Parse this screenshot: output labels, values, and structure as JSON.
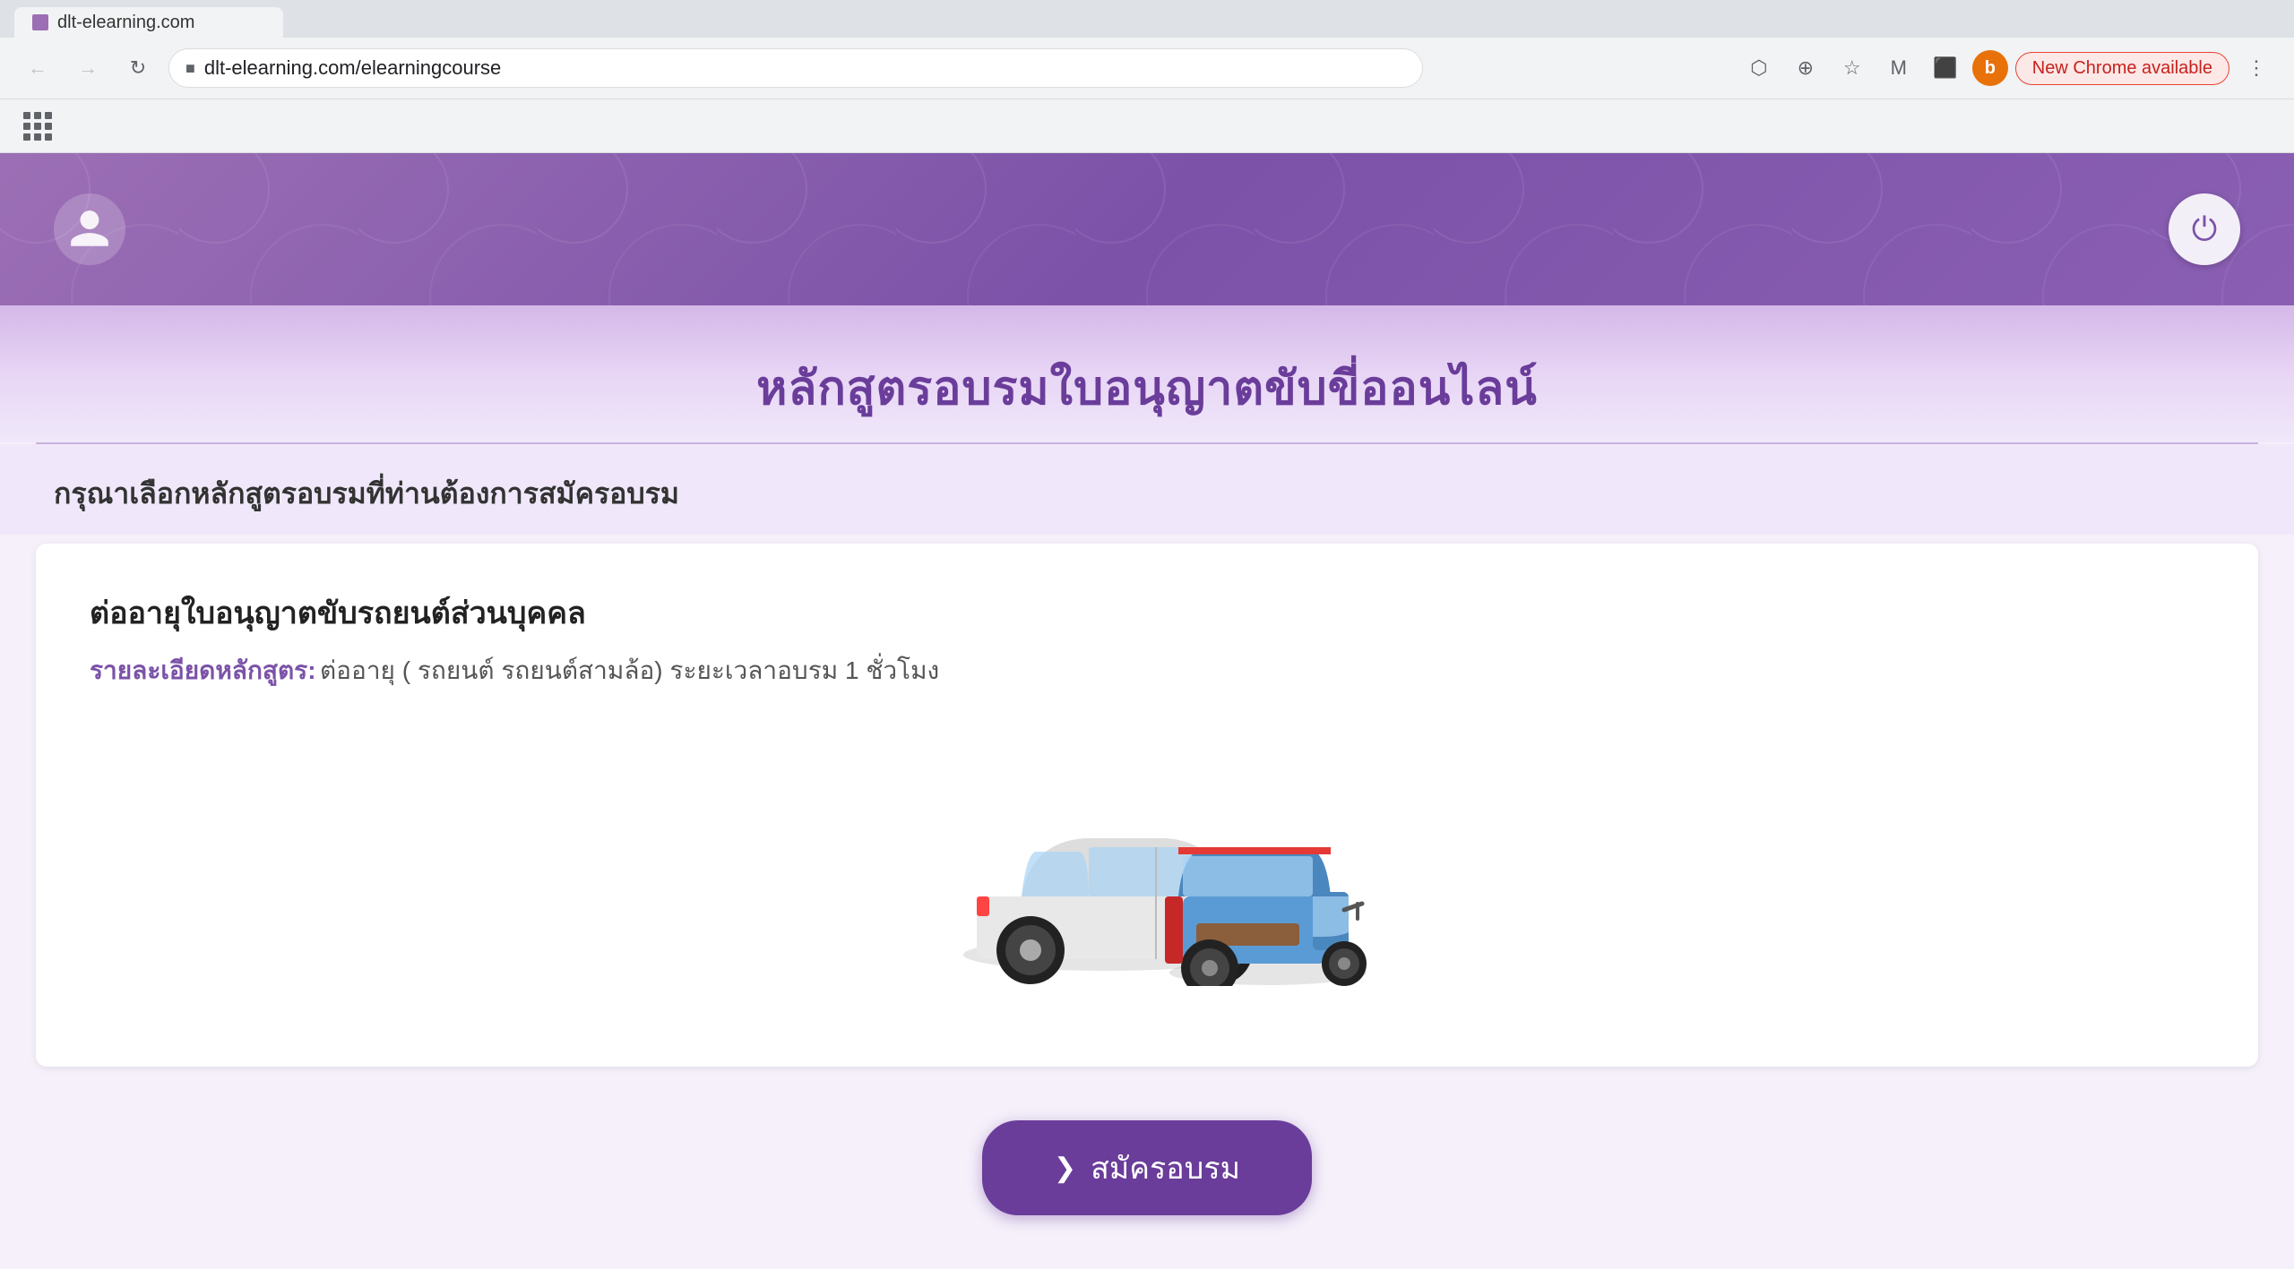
{
  "browser": {
    "back_disabled": true,
    "forward_disabled": true,
    "url": "dlt-elearning.com/elearningcourse",
    "new_chrome_label": "New Chrome available",
    "profile_letter": "b",
    "apps_title": "Google apps"
  },
  "header": {
    "power_button_title": "ออกจากระบบ"
  },
  "page": {
    "title": "หลักสูตรอบรมใบอนุญาตขับขี่ออนไลน์",
    "subtitle": "กรุณาเลือกหลักสูตรอบรมที่ท่านต้องการสมัครอบรม",
    "course": {
      "title": "ต่ออายุใบอนุญาตขับรถยนต์ส่วนบุคคล",
      "detail_label": "รายละเอียดหลักสูตร:",
      "detail_text": " ต่ออายุ ( รถยนต์ รถยนต์สามล้อ) ระยะเวลาอบรม 1 ชั่วโมง"
    },
    "register_button": "สมัครอบรม"
  }
}
